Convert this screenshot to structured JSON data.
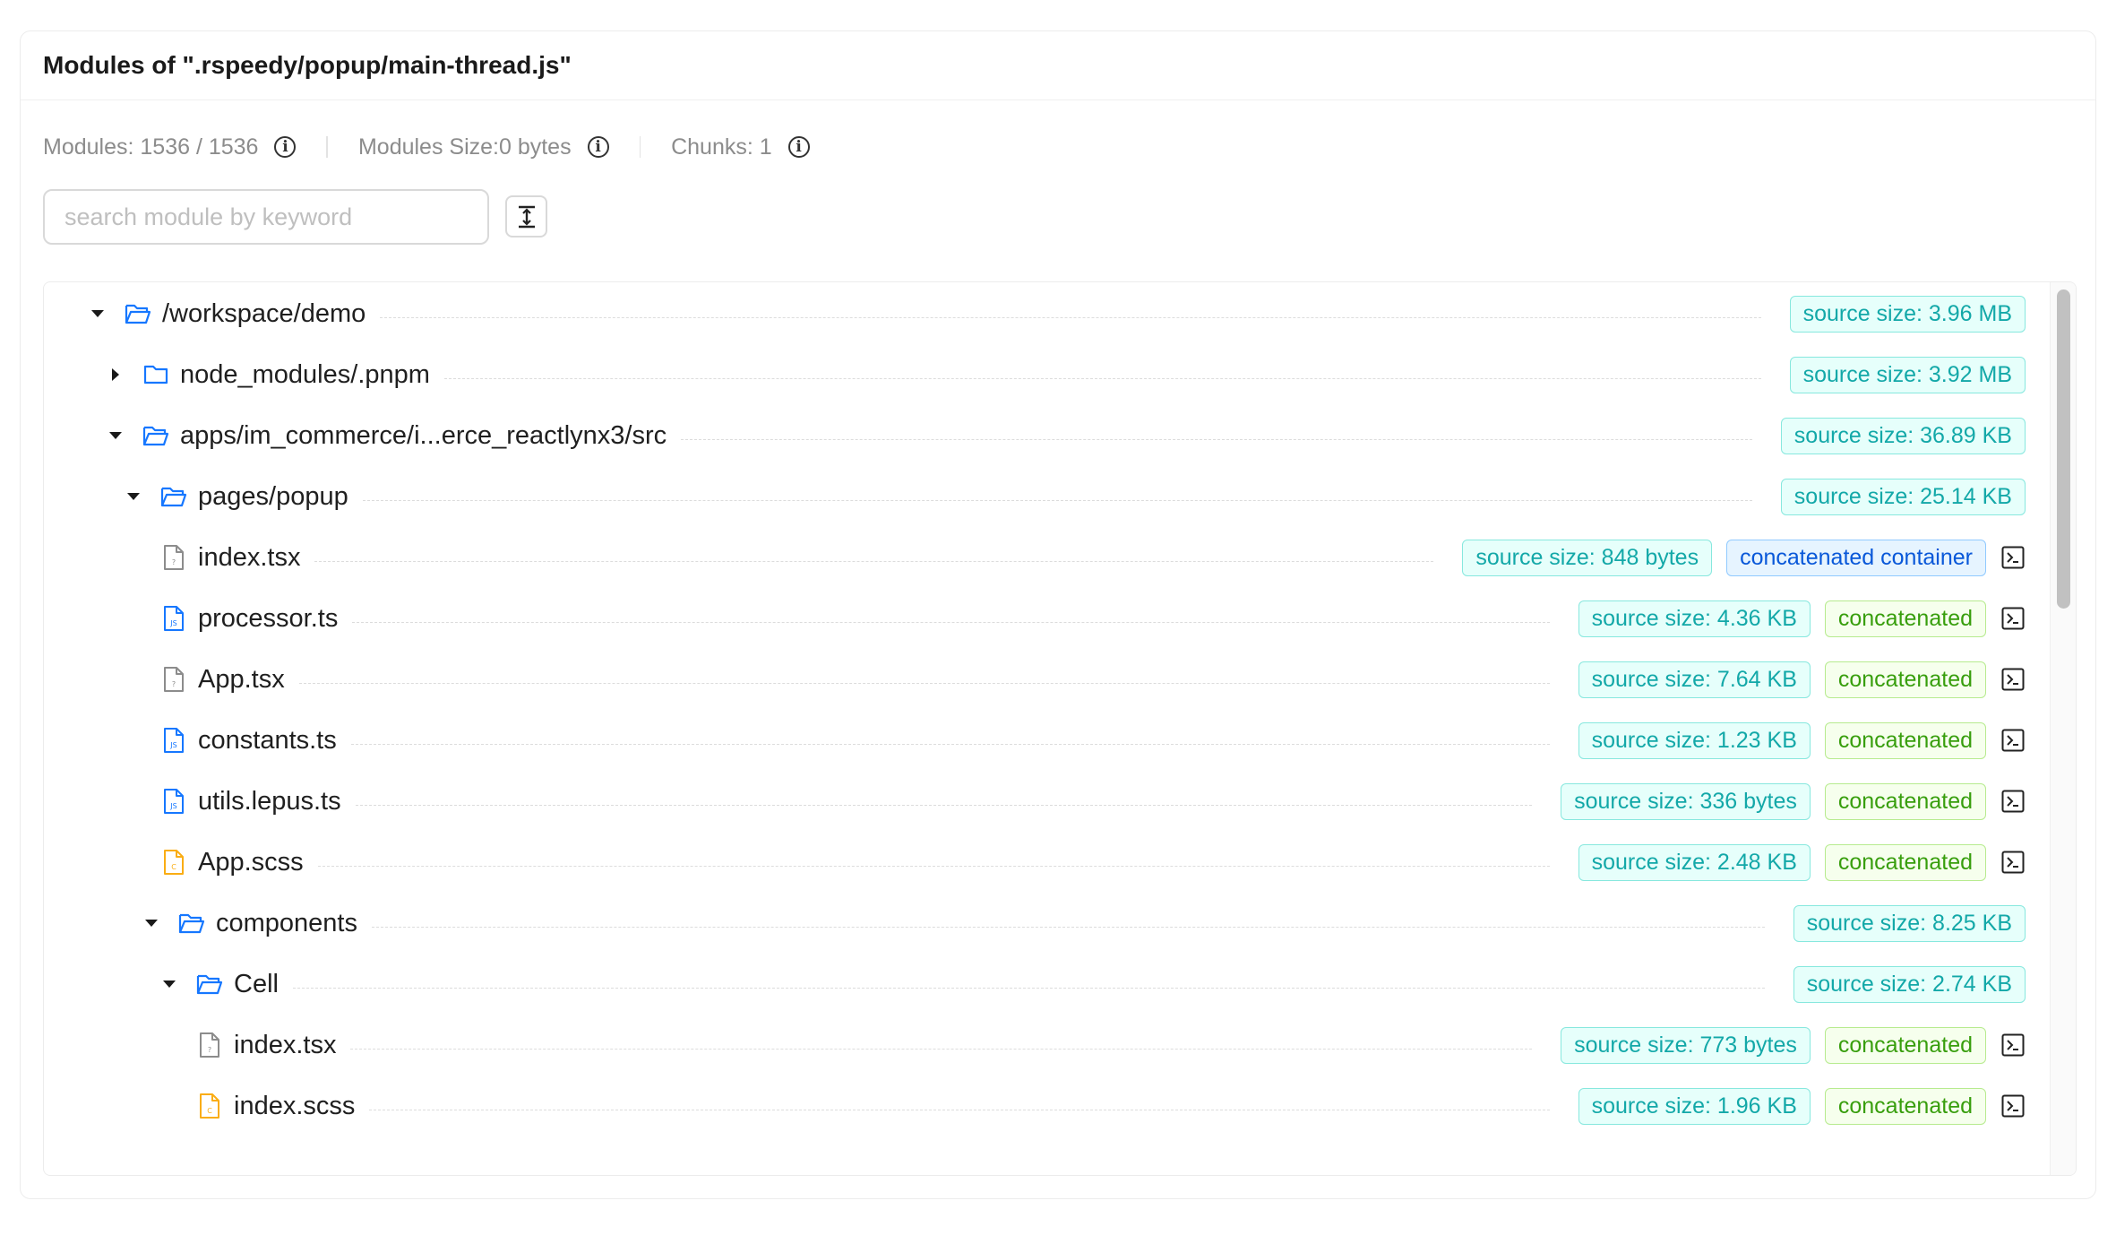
{
  "header": {
    "title": "Modules of \".rspeedy/popup/main-thread.js\""
  },
  "stats": {
    "modules": "Modules: 1536 / 1536",
    "size": "Modules Size:0 bytes",
    "chunks": "Chunks: 1"
  },
  "search": {
    "placeholder": "search module by keyword",
    "value": ""
  },
  "tree": [
    {
      "label": "/workspace/demo",
      "type": "folder",
      "expanded": true,
      "depth": 0,
      "size": "source size: 3.96 MB"
    },
    {
      "label": "node_modules/.pnpm",
      "type": "folder",
      "expanded": false,
      "depth": 1,
      "size": "source size: 3.92 MB"
    },
    {
      "label": "apps/im_commerce/i...erce_reactlynx3/src",
      "type": "folder",
      "expanded": true,
      "depth": 1,
      "size": "source size: 36.89 KB"
    },
    {
      "label": "pages/popup",
      "type": "folder",
      "expanded": true,
      "depth": 2,
      "size": "source size: 25.14 KB"
    },
    {
      "label": "index.tsx",
      "type": "file-tsx",
      "depth": 3,
      "size": "source size: 848 bytes",
      "status": "concatenated container",
      "status_kind": "container"
    },
    {
      "label": "processor.ts",
      "type": "file-js",
      "depth": 3,
      "size": "source size: 4.36 KB",
      "status": "concatenated",
      "status_kind": "concat"
    },
    {
      "label": "App.tsx",
      "type": "file-tsx",
      "depth": 3,
      "size": "source size: 7.64 KB",
      "status": "concatenated",
      "status_kind": "concat"
    },
    {
      "label": "constants.ts",
      "type": "file-js",
      "depth": 3,
      "size": "source size: 1.23 KB",
      "status": "concatenated",
      "status_kind": "concat"
    },
    {
      "label": "utils.lepus.ts",
      "type": "file-js",
      "depth": 3,
      "size": "source size: 336 bytes",
      "status": "concatenated",
      "status_kind": "concat"
    },
    {
      "label": "App.scss",
      "type": "file-css",
      "depth": 3,
      "size": "source size: 2.48 KB",
      "status": "concatenated",
      "status_kind": "concat"
    },
    {
      "label": "components",
      "type": "folder",
      "expanded": true,
      "depth": 3,
      "size": "source size: 8.25 KB"
    },
    {
      "label": "Cell",
      "type": "folder",
      "expanded": true,
      "depth": 4,
      "size": "source size: 2.74 KB"
    },
    {
      "label": "index.tsx",
      "type": "file-tsx",
      "depth": 5,
      "size": "source size: 773 bytes",
      "status": "concatenated",
      "status_kind": "concat"
    },
    {
      "label": "index.scss",
      "type": "file-css",
      "depth": 5,
      "size": "source size: 1.96 KB",
      "status": "concatenated",
      "status_kind": "concat"
    }
  ],
  "colors": {
    "accent": "#1677ff",
    "size_tag": "#13a8a8",
    "concat_tag": "#389e0d",
    "container_tag": "#0958d9",
    "css_file": "#faad14"
  }
}
